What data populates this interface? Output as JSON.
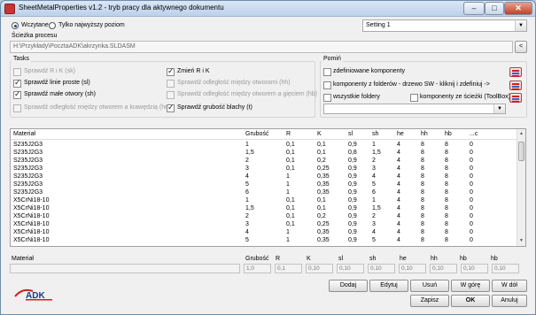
{
  "window": {
    "title": "SheetMetalProperties v1.2 - tryb pracy dla aktywnego dokumentu"
  },
  "mode": {
    "option1": "Wczytane",
    "option2": "Tylko najwyższy poziom"
  },
  "setting": {
    "value": "Setting 1"
  },
  "path": {
    "label": "Ścieżka procesu",
    "value": "H:\\Przykłady\\PocztaADK\\akrzynka.SLDASM",
    "browse": "<"
  },
  "tasks": {
    "title": "Tasks",
    "items": [
      {
        "label": "Sprawdź R i K (sk)",
        "checked": false,
        "enabled": false
      },
      {
        "label": "Sprawdź linie proste (sl)",
        "checked": true,
        "enabled": true
      },
      {
        "label": "Sprawdź małe otwory (sh)",
        "checked": true,
        "enabled": true
      },
      {
        "label": "Sprawdź odległość między otworem a krawędzią (he)",
        "checked": false,
        "enabled": false
      },
      {
        "label": "Zmień R i K",
        "checked": true,
        "enabled": true
      },
      {
        "label": "Sprawdź odległość między otworami (hh)",
        "checked": false,
        "enabled": false
      },
      {
        "label": "Sprawdź odległość między otworem a gięciem (hb)",
        "checked": false,
        "enabled": false
      },
      {
        "label": "Sprawdź grubość blachy (t)",
        "checked": true,
        "enabled": true
      }
    ]
  },
  "skip": {
    "title": "Pomiń",
    "items": [
      "zdefiniowane komponenty",
      "komponenty z folderów - drzewo SW - kliknij i zdefiniuj ->",
      "wszystkie foldery",
      "komponenty ze ścieżki (ToolBox)"
    ]
  },
  "table": {
    "columns": [
      "Materiał",
      "Grubość",
      "R",
      "K",
      "sl",
      "sh",
      "he",
      "hh",
      "hb",
      "...c"
    ],
    "rows": [
      [
        "S235J2G3",
        "1",
        "0,1",
        "0,1",
        "0,9",
        "1",
        "4",
        "8",
        "8",
        "0"
      ],
      [
        "S235J2G3",
        "1,5",
        "0,1",
        "0,1",
        "0,8",
        "1,5",
        "4",
        "8",
        "8",
        "0"
      ],
      [
        "S235J2G3",
        "2",
        "0,1",
        "0,2",
        "0,9",
        "2",
        "4",
        "8",
        "8",
        "0"
      ],
      [
        "S235J2G3",
        "3",
        "0,1",
        "0,25",
        "0,9",
        "3",
        "4",
        "8",
        "8",
        "0"
      ],
      [
        "S235J2G3",
        "4",
        "1",
        "0,35",
        "0,9",
        "4",
        "4",
        "8",
        "8",
        "0"
      ],
      [
        "S235J2G3",
        "5",
        "1",
        "0,35",
        "0,9",
        "5",
        "4",
        "8",
        "8",
        "0"
      ],
      [
        "S235J2G3",
        "6",
        "1",
        "0,35",
        "0,9",
        "6",
        "4",
        "8",
        "8",
        "0"
      ],
      [
        "X5CrNi18-10",
        "1",
        "0,1",
        "0,1",
        "0,9",
        "1",
        "4",
        "8",
        "8",
        "0"
      ],
      [
        "X5CrNi18-10",
        "1,5",
        "0,1",
        "0,1",
        "0,9",
        "1,5",
        "4",
        "8",
        "8",
        "0"
      ],
      [
        "X5CrNi18-10",
        "2",
        "0,1",
        "0,2",
        "0,9",
        "2",
        "4",
        "8",
        "8",
        "0"
      ],
      [
        "X5CrNi18-10",
        "3",
        "0,1",
        "0,25",
        "0,9",
        "3",
        "4",
        "8",
        "8",
        "0"
      ],
      [
        "X5CrNi18-10",
        "4",
        "1",
        "0,35",
        "0,9",
        "4",
        "4",
        "8",
        "8",
        "0"
      ],
      [
        "X5CrNi18-10",
        "5",
        "1",
        "0,35",
        "0,9",
        "5",
        "4",
        "8",
        "8",
        "0"
      ]
    ]
  },
  "editor": {
    "labels": [
      "Materiał",
      "Grubość",
      "R",
      "K",
      "sl",
      "sh",
      "he",
      "hh",
      "hb",
      "hb"
    ],
    "values": [
      "",
      "1,0",
      "0,1",
      "0,10",
      "0,10",
      "0,10",
      "0,10",
      "0,10",
      "0,10",
      "0,10"
    ]
  },
  "buttons": {
    "add": "Dodaj",
    "edit": "Edytuj",
    "remove": "Usuń",
    "up": "W górę",
    "down": "W dół",
    "save": "Zapisz",
    "ok": "OK",
    "cancel": "Anuluj"
  },
  "logo": {
    "text": "ADK"
  }
}
